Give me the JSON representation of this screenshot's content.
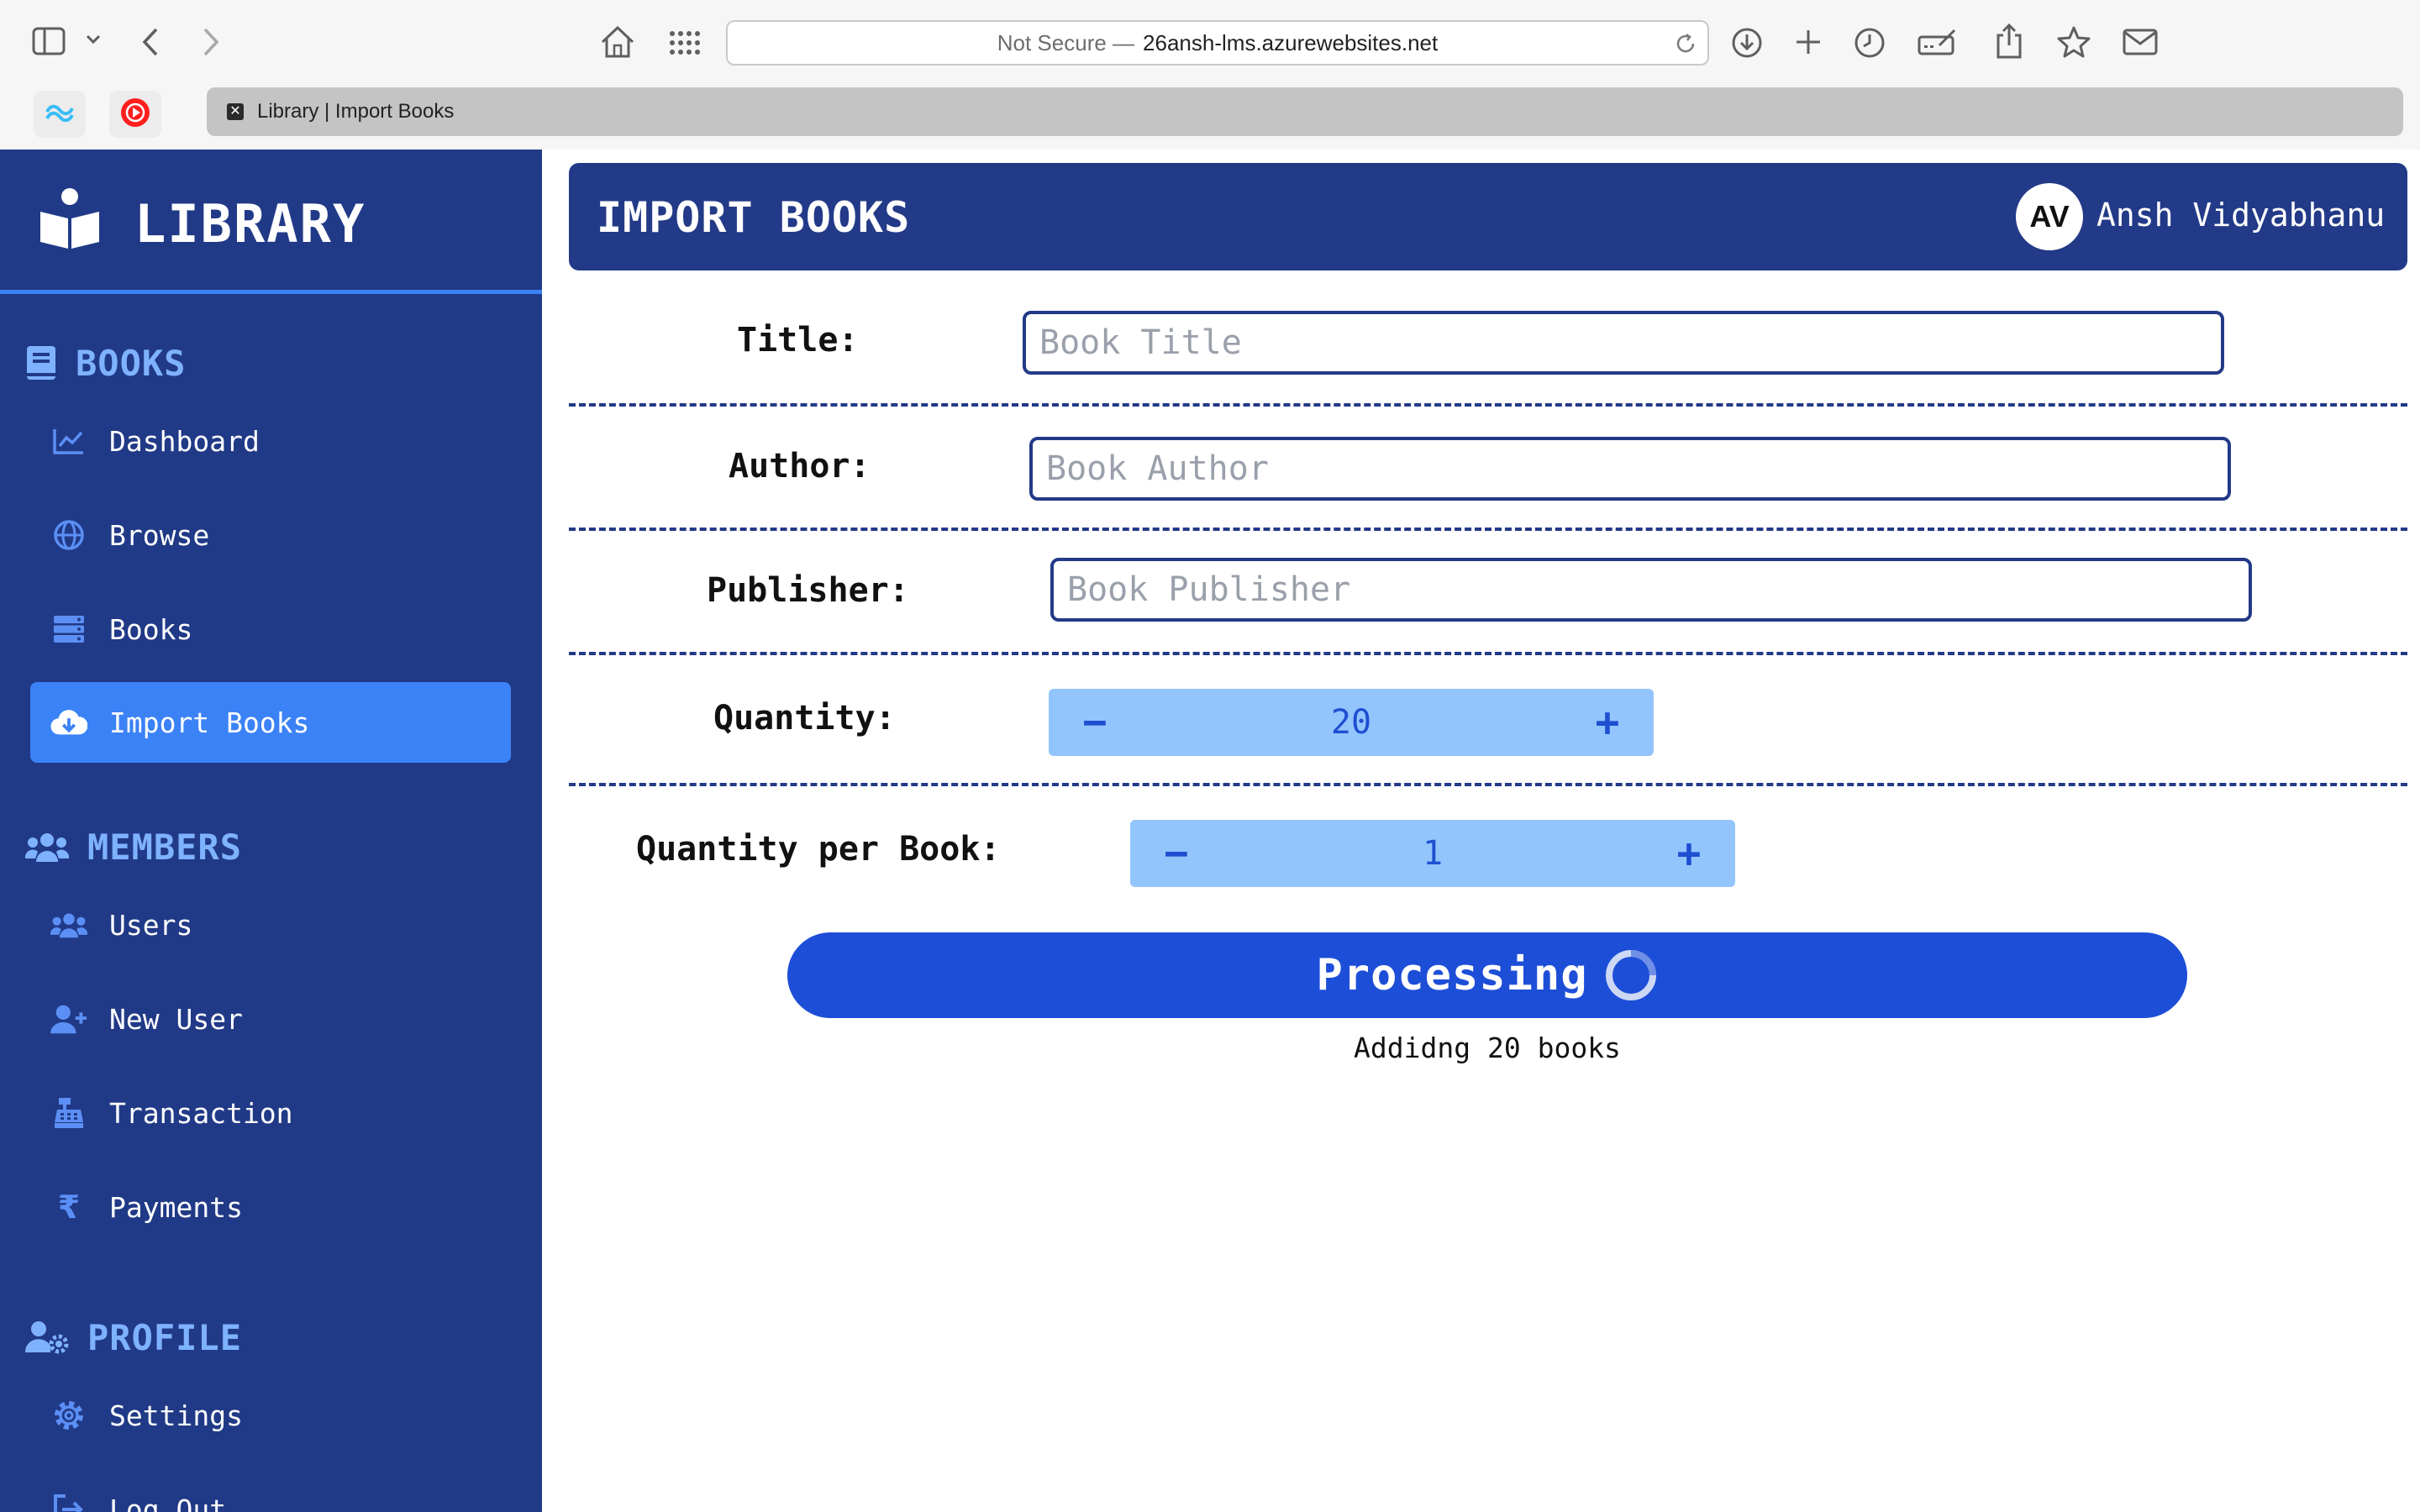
{
  "browser": {
    "address_prefix": "Not Secure —",
    "address_domain": "26ansh-lms.azurewebsites.net",
    "tab_title": "Library | Import Books",
    "icons": [
      "sidebar-icon",
      "chevron-down-icon",
      "back-icon",
      "forward-icon",
      "home-icon",
      "grid-icon",
      "reload-icon",
      "download-icon",
      "new-tab-icon",
      "history-icon",
      "edit-icon",
      "share-icon",
      "bookmark-star-icon",
      "mail-icon"
    ]
  },
  "sidebar": {
    "brand": "LIBRARY",
    "sections": [
      {
        "title": "BOOKS",
        "icon": "book-icon",
        "items": [
          {
            "label": "Dashboard",
            "icon": "chart-line-icon"
          },
          {
            "label": "Browse",
            "icon": "globe-icon"
          },
          {
            "label": "Books",
            "icon": "server-icon"
          },
          {
            "label": "Import Books",
            "icon": "cloud-download-icon",
            "active": true
          }
        ]
      },
      {
        "title": "MEMBERS",
        "icon": "users-icon",
        "items": [
          {
            "label": "Users",
            "icon": "users-icon"
          },
          {
            "label": "New User",
            "icon": "user-plus-icon"
          },
          {
            "label": "Transaction",
            "icon": "cash-register-icon"
          },
          {
            "label": "Payments",
            "icon": "rupee-icon"
          }
        ]
      },
      {
        "title": "PROFILE",
        "icon": "user-gear-icon",
        "items": [
          {
            "label": "Settings",
            "icon": "gear-icon"
          },
          {
            "label": "Log Out",
            "icon": "logout-icon"
          }
        ]
      }
    ]
  },
  "header": {
    "title": "IMPORT BOOKS",
    "avatar_initials": "AV",
    "user_name": "Ansh Vidyabhanu"
  },
  "form": {
    "title_label": "Title:",
    "title_placeholder": "Book Title",
    "author_label": "Author:",
    "author_placeholder": "Book Author",
    "publisher_label": "Publisher:",
    "publisher_placeholder": "Book Publisher",
    "quantity_label": "Quantity:",
    "quantity_value": "20",
    "qpb_label": "Quantity per Book:",
    "qpb_value": "1",
    "minus": "−",
    "plus": "+"
  },
  "action": {
    "button_label": "Processing",
    "status_text": "Addidng 20 books"
  },
  "colors": {
    "sidebar_bg": "#213a87",
    "accent": "#3b82f6",
    "stepper_bg": "#93c5fd",
    "button_bg": "#1d4ed8"
  }
}
